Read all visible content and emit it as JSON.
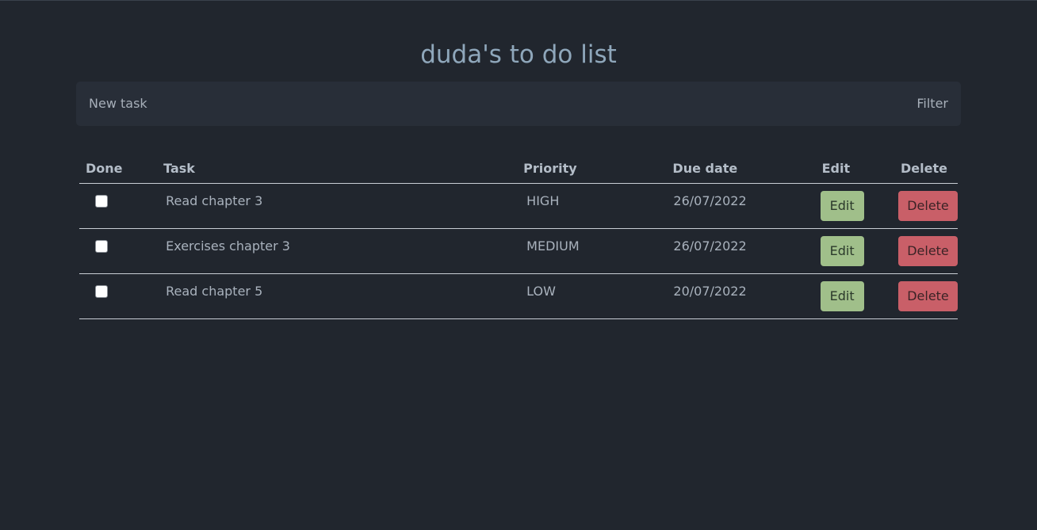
{
  "page": {
    "title": "duda's to do list"
  },
  "toolbar": {
    "new_task_label": "New task",
    "filter_label": "Filter"
  },
  "table": {
    "headers": {
      "done": "Done",
      "task": "Task",
      "priority": "Priority",
      "due_date": "Due date",
      "edit": "Edit",
      "delete": "Delete"
    },
    "rows": [
      {
        "done": false,
        "task": "Read chapter 3",
        "priority": "HIGH",
        "due_date": "26/07/2022",
        "edit_label": "Edit",
        "delete_label": "Delete"
      },
      {
        "done": false,
        "task": "Exercises chapter 3",
        "priority": "MEDIUM",
        "due_date": "26/07/2022",
        "edit_label": "Edit",
        "delete_label": "Delete"
      },
      {
        "done": false,
        "task": "Read chapter 5",
        "priority": "LOW",
        "due_date": "20/07/2022",
        "edit_label": "Edit",
        "delete_label": "Delete"
      }
    ]
  },
  "colors": {
    "background": "#21262e",
    "toolbar": "#282e38",
    "title": "#8fa7bb",
    "edit_button": "#a0bf8a",
    "delete_button": "#c95f68"
  }
}
